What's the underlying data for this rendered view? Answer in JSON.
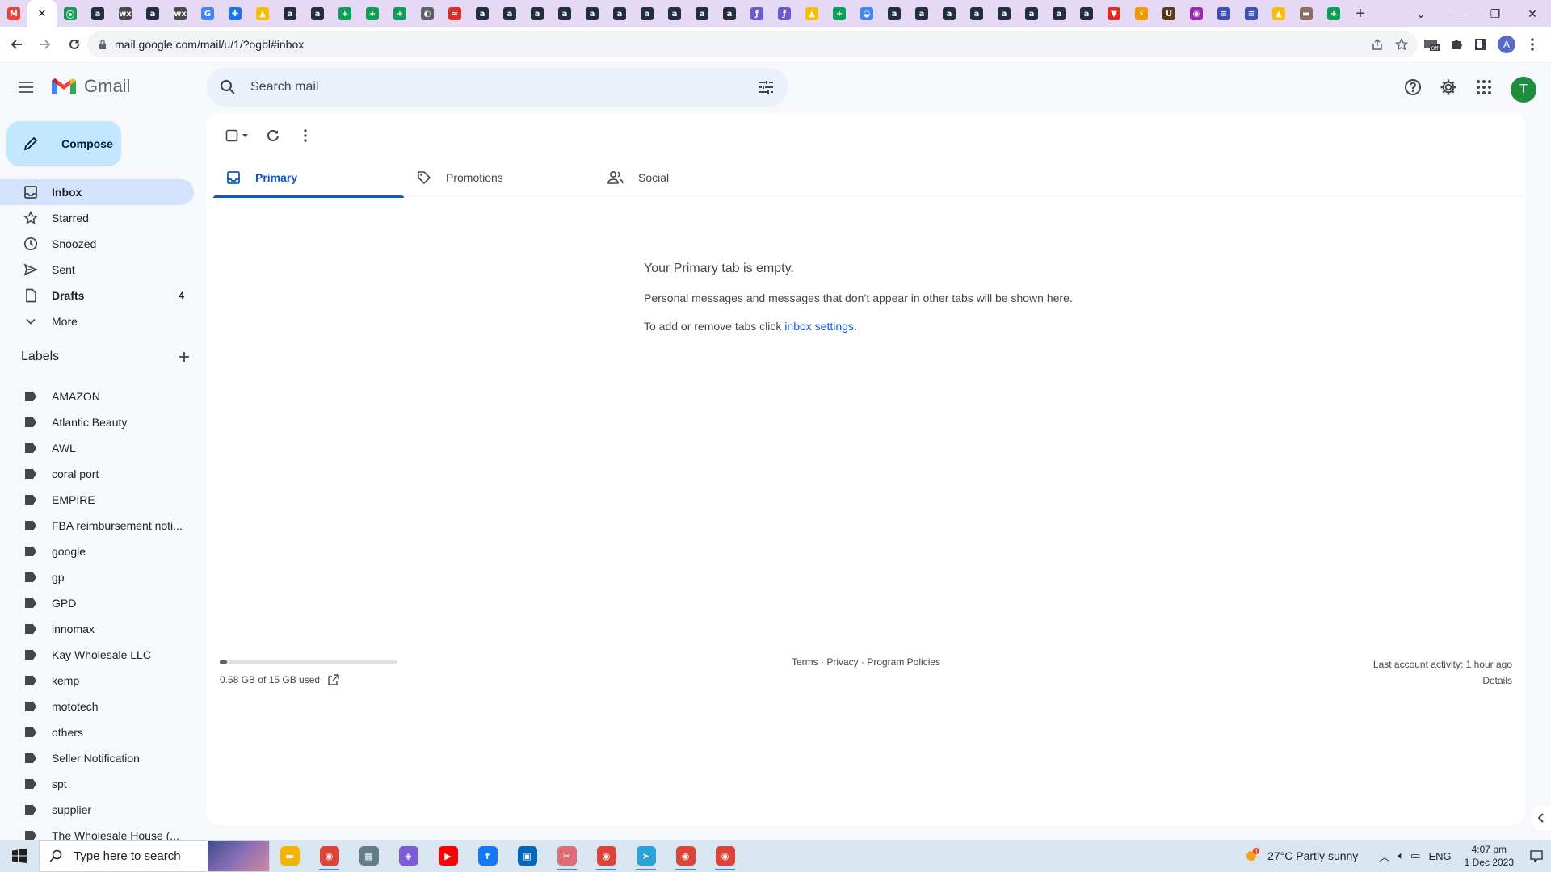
{
  "browser": {
    "tab_favicons": [
      {
        "name": "gmail-tab",
        "letter": "M",
        "color": "#ea4335"
      },
      {
        "name": "active-tab",
        "letter": "✕",
        "color": "#202124"
      },
      {
        "name": "green-tab",
        "letter": "⦿",
        "color": "#0f9d58"
      },
      {
        "name": "amazon-tab",
        "letter": "a",
        "color": "#232f3e"
      },
      {
        "name": "wix-tab",
        "letter": "wx",
        "color": "#4a4a4a"
      },
      {
        "name": "amazon-tab",
        "letter": "a",
        "color": "#232f3e"
      },
      {
        "name": "wix-tab",
        "letter": "wx",
        "color": "#4a4a4a"
      },
      {
        "name": "google-tab",
        "letter": "G",
        "color": "#4285f4"
      },
      {
        "name": "extension-tab",
        "letter": "✚",
        "color": "#1a73e8"
      },
      {
        "name": "drive-tab",
        "letter": "▲",
        "color": "#fbbc04"
      },
      {
        "name": "amazon-tab",
        "letter": "a",
        "color": "#232f3e"
      },
      {
        "name": "amazon-tab",
        "letter": "a",
        "color": "#232f3e"
      },
      {
        "name": "sheets-tab",
        "letter": "+",
        "color": "#0f9d58"
      },
      {
        "name": "sheets-tab",
        "letter": "+",
        "color": "#0f9d58"
      },
      {
        "name": "sheets-tab",
        "letter": "+",
        "color": "#0f9d58"
      },
      {
        "name": "globe-tab",
        "letter": "◐",
        "color": "#5f6368"
      },
      {
        "name": "misc-tab",
        "letter": "≈",
        "color": "#d93025"
      },
      {
        "name": "amazon-tab",
        "letter": "a",
        "color": "#232f3e"
      },
      {
        "name": "amazon-tab",
        "letter": "a",
        "color": "#232f3e"
      },
      {
        "name": "amazon-tab",
        "letter": "a",
        "color": "#232f3e"
      },
      {
        "name": "amazon-tab",
        "letter": "a",
        "color": "#232f3e"
      },
      {
        "name": "amazon-tab",
        "letter": "a",
        "color": "#232f3e"
      },
      {
        "name": "amazon-tab",
        "letter": "a",
        "color": "#232f3e"
      },
      {
        "name": "amazon-tab",
        "letter": "a",
        "color": "#232f3e"
      },
      {
        "name": "amazon-tab",
        "letter": "a",
        "color": "#232f3e"
      },
      {
        "name": "amazon-tab",
        "letter": "a",
        "color": "#232f3e"
      },
      {
        "name": "amazon-tab",
        "letter": "a",
        "color": "#232f3e"
      },
      {
        "name": "misc-tab",
        "letter": "ƒ",
        "color": "#6a5acd"
      },
      {
        "name": "misc-tab",
        "letter": "ƒ",
        "color": "#6a5acd"
      },
      {
        "name": "drive-tab",
        "letter": "▲",
        "color": "#fbbc04"
      },
      {
        "name": "sheets-tab",
        "letter": "+",
        "color": "#0f9d58"
      },
      {
        "name": "misc-tab",
        "letter": "◒",
        "color": "#4285f4"
      },
      {
        "name": "amazon-tab",
        "letter": "a",
        "color": "#232f3e"
      },
      {
        "name": "amazon-tab",
        "letter": "a",
        "color": "#232f3e"
      },
      {
        "name": "amazon-tab",
        "letter": "a",
        "color": "#232f3e"
      },
      {
        "name": "amazon-tab",
        "letter": "a",
        "color": "#232f3e"
      },
      {
        "name": "amazon-tab",
        "letter": "a",
        "color": "#232f3e"
      },
      {
        "name": "amazon-tab",
        "letter": "a",
        "color": "#232f3e"
      },
      {
        "name": "amazon-tab",
        "letter": "a",
        "color": "#232f3e"
      },
      {
        "name": "amazon-tab",
        "letter": "a",
        "color": "#232f3e"
      },
      {
        "name": "misc-tab",
        "letter": "▼",
        "color": "#d93025"
      },
      {
        "name": "misc-tab",
        "letter": "⚡",
        "color": "#f29900"
      },
      {
        "name": "ups-tab",
        "letter": "U",
        "color": "#5b3a1a"
      },
      {
        "name": "misc-tab",
        "letter": "◉",
        "color": "#9c27b0"
      },
      {
        "name": "forms-tab",
        "letter": "≡",
        "color": "#3f51b5"
      },
      {
        "name": "forms-tab",
        "letter": "≡",
        "color": "#3f51b5"
      },
      {
        "name": "drive-tab",
        "letter": "▲",
        "color": "#fbbc04"
      },
      {
        "name": "misc-tab",
        "letter": "▬",
        "color": "#8d6e63"
      },
      {
        "name": "sheets-tab",
        "letter": "+",
        "color": "#0f9d58"
      }
    ],
    "new_tab": "+",
    "url": "mail.google.com/mail/u/1/?ogbl#inbox",
    "profile_initial": "A"
  },
  "gmail": {
    "wordmark": "Gmail",
    "search_placeholder": "Search mail",
    "avatar_initial": "T",
    "compose_label": "Compose",
    "nav": [
      {
        "name": "nav-inbox",
        "icon": "inbox-icon",
        "label": "Inbox",
        "count": "",
        "active": true,
        "bold": true
      },
      {
        "name": "nav-starred",
        "icon": "star-icon",
        "label": "Starred",
        "count": "",
        "active": false,
        "bold": false
      },
      {
        "name": "nav-snoozed",
        "icon": "clock-icon",
        "label": "Snoozed",
        "count": "",
        "active": false,
        "bold": false
      },
      {
        "name": "nav-sent",
        "icon": "send-icon",
        "label": "Sent",
        "count": "",
        "active": false,
        "bold": false
      },
      {
        "name": "nav-drafts",
        "icon": "draft-icon",
        "label": "Drafts",
        "count": "4",
        "active": false,
        "bold": true
      },
      {
        "name": "nav-more",
        "icon": "chevron-down-icon",
        "label": "More",
        "count": "",
        "active": false,
        "bold": false
      }
    ],
    "labels_title": "Labels",
    "labels": [
      "AMAZON",
      "Atlantic Beauty",
      "AWL",
      "coral port",
      "EMPIRE",
      "FBA reimbursement noti...",
      "google",
      "gp",
      "GPD",
      "innomax",
      "Kay Wholesale LLC",
      "kemp",
      "mototech",
      "others",
      "Seller Notification",
      "spt",
      "supplier",
      "The Wholesale House (..."
    ],
    "tabs": [
      {
        "name": "tab-primary",
        "icon": "inbox-icon",
        "label": "Primary",
        "active": true
      },
      {
        "name": "tab-promotions",
        "icon": "tag-icon",
        "label": "Promotions",
        "active": false
      },
      {
        "name": "tab-social",
        "icon": "people-icon",
        "label": "Social",
        "active": false
      }
    ],
    "empty": {
      "title": "Your Primary tab is empty.",
      "description": "Personal messages and messages that don’t appear in other tabs will be shown here.",
      "tabs_prefix": "To add or remove tabs click ",
      "tabs_link": "inbox settings",
      "tabs_suffix": "."
    },
    "storage": {
      "text": "0.58 GB of 15 GB used",
      "used_fraction": 0.039
    },
    "footer_links": "Terms · Privacy · Program Policies",
    "last_activity": "Last account activity: 1 hour ago",
    "details": "Details",
    "accent": "#0b57d0"
  },
  "taskbar": {
    "search_text": "Type here to search",
    "apps": [
      {
        "name": "file-explorer-app",
        "glyph": "▬",
        "color": "#f4b400",
        "running": false
      },
      {
        "name": "chrome-app",
        "glyph": "◉",
        "color": "#db4437",
        "running": true
      },
      {
        "name": "calculator-app",
        "glyph": "▦",
        "color": "#607d8b",
        "running": false
      },
      {
        "name": "copilot-app",
        "glyph": "◈",
        "color": "#7b5cd6",
        "running": false
      },
      {
        "name": "youtube-app",
        "glyph": "▶",
        "color": "#ff0000",
        "running": false
      },
      {
        "name": "facebook-app",
        "glyph": "f",
        "color": "#1877f2",
        "running": false
      },
      {
        "name": "store-app",
        "glyph": "▣",
        "color": "#0067b8",
        "running": false
      },
      {
        "name": "snipping-app",
        "glyph": "✂",
        "color": "#e06c75",
        "running": true
      },
      {
        "name": "chrome-profile-app",
        "glyph": "◉",
        "color": "#db4437",
        "running": true
      },
      {
        "name": "telegram-app",
        "glyph": "➤",
        "color": "#2aa3db",
        "running": true
      },
      {
        "name": "chrome-profile-a-app",
        "glyph": "◉",
        "color": "#db4437",
        "running": true
      },
      {
        "name": "chrome-profile-c-app",
        "glyph": "◉",
        "color": "#db4437",
        "running": true
      }
    ],
    "weather": "27°C  Partly sunny",
    "language": "ENG",
    "time": "4:07 pm",
    "date": "1 Dec 2023"
  }
}
